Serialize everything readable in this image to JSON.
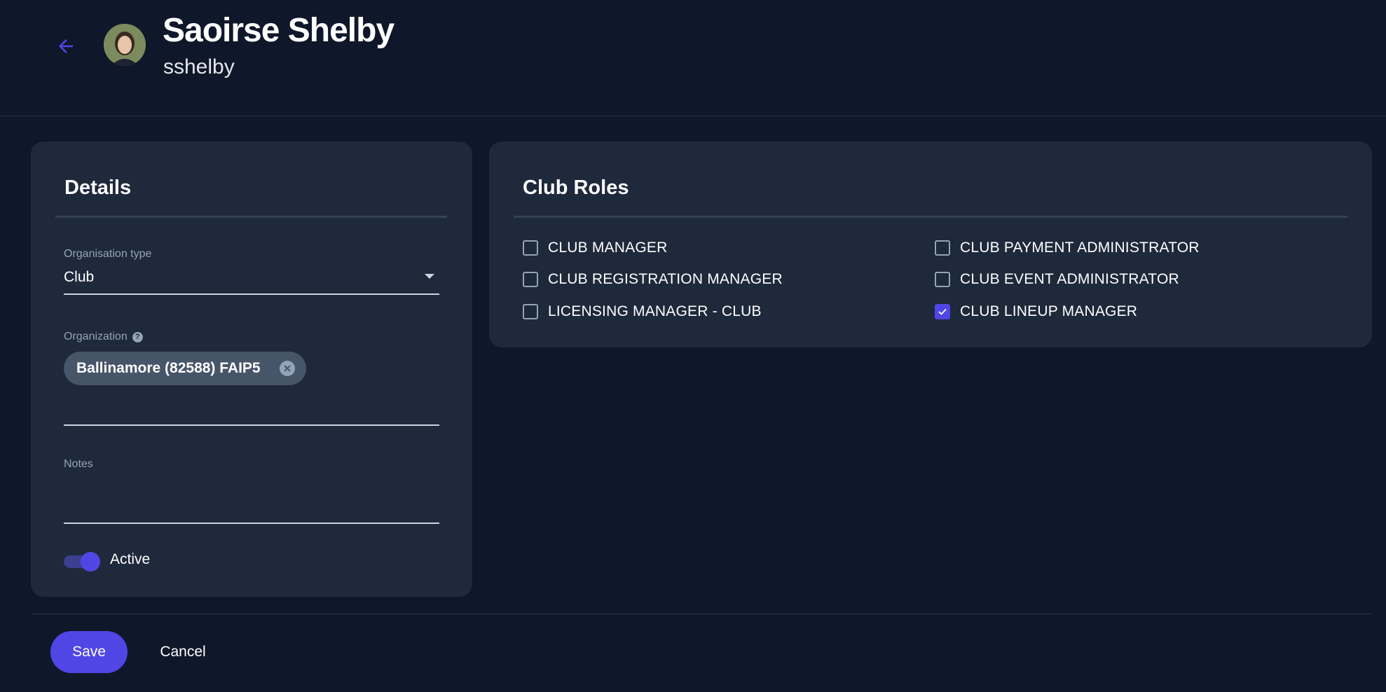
{
  "header": {
    "user_name": "Saoirse Shelby",
    "username": "sshelby"
  },
  "details": {
    "title": "Details",
    "org_type_label": "Organisation type",
    "org_type_value": "Club",
    "organization_label": "Organization",
    "organization_chip": "Ballinamore (82588) FAIP5",
    "notes_label": "Notes",
    "notes_value": "",
    "active_label": "Active",
    "active": true
  },
  "roles": {
    "title": "Club Roles",
    "items": [
      {
        "label": "CLUB MANAGER",
        "checked": false
      },
      {
        "label": "CLUB REGISTRATION MANAGER",
        "checked": false
      },
      {
        "label": "LICENSING MANAGER - CLUB",
        "checked": false
      },
      {
        "label": "CLUB PAYMENT ADMINISTRATOR",
        "checked": false
      },
      {
        "label": "CLUB EVENT ADMINISTRATOR",
        "checked": false
      },
      {
        "label": "CLUB LINEUP MANAGER",
        "checked": true
      }
    ]
  },
  "footer": {
    "save_label": "Save",
    "cancel_label": "Cancel"
  },
  "colors": {
    "background": "#0f172a",
    "card": "#1e293b",
    "accent": "#5046e5",
    "muted_text": "#94a3b8"
  }
}
